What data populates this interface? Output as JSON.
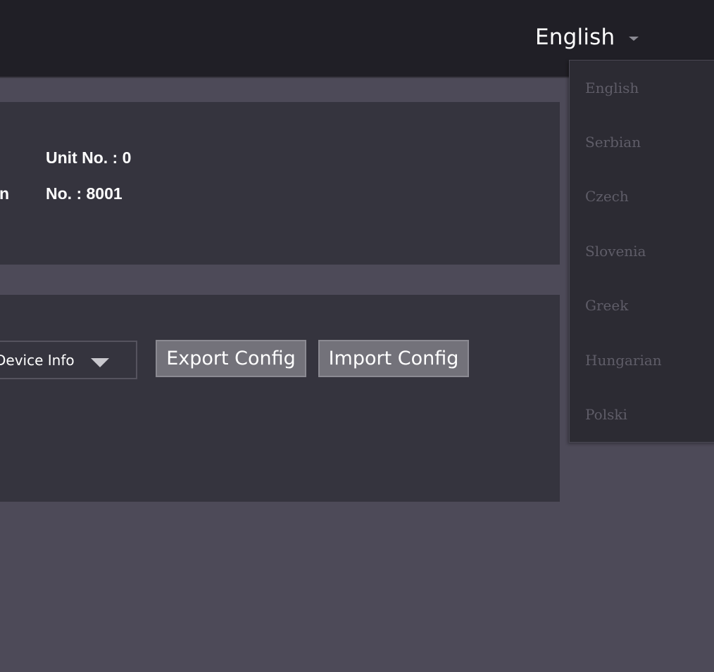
{
  "header": {
    "language_selected": "English"
  },
  "language_menu": {
    "options": [
      "English",
      "Serbian",
      "Czech",
      "Slovenia",
      "Greek",
      "Hungarian",
      "Polski"
    ]
  },
  "info_panel": {
    "unit_no": "Unit No. : 0",
    "no_partial_label": "n",
    "no_value": "No. : 8001"
  },
  "config_panel": {
    "select_value": "Device Info",
    "export_label": "Export Config",
    "import_label": "Import Config"
  },
  "colors": {
    "page_bg": "#4d4a58",
    "topbar_bg": "#201f26",
    "panel_bg": "#35343e",
    "button_bg": "#73727a",
    "dropdown_bg": "#2c2b33",
    "dropdown_text": "#5f5d68"
  },
  "icons": {
    "language_caret": "chevron-down-icon",
    "select_caret": "triangle-down-icon"
  }
}
